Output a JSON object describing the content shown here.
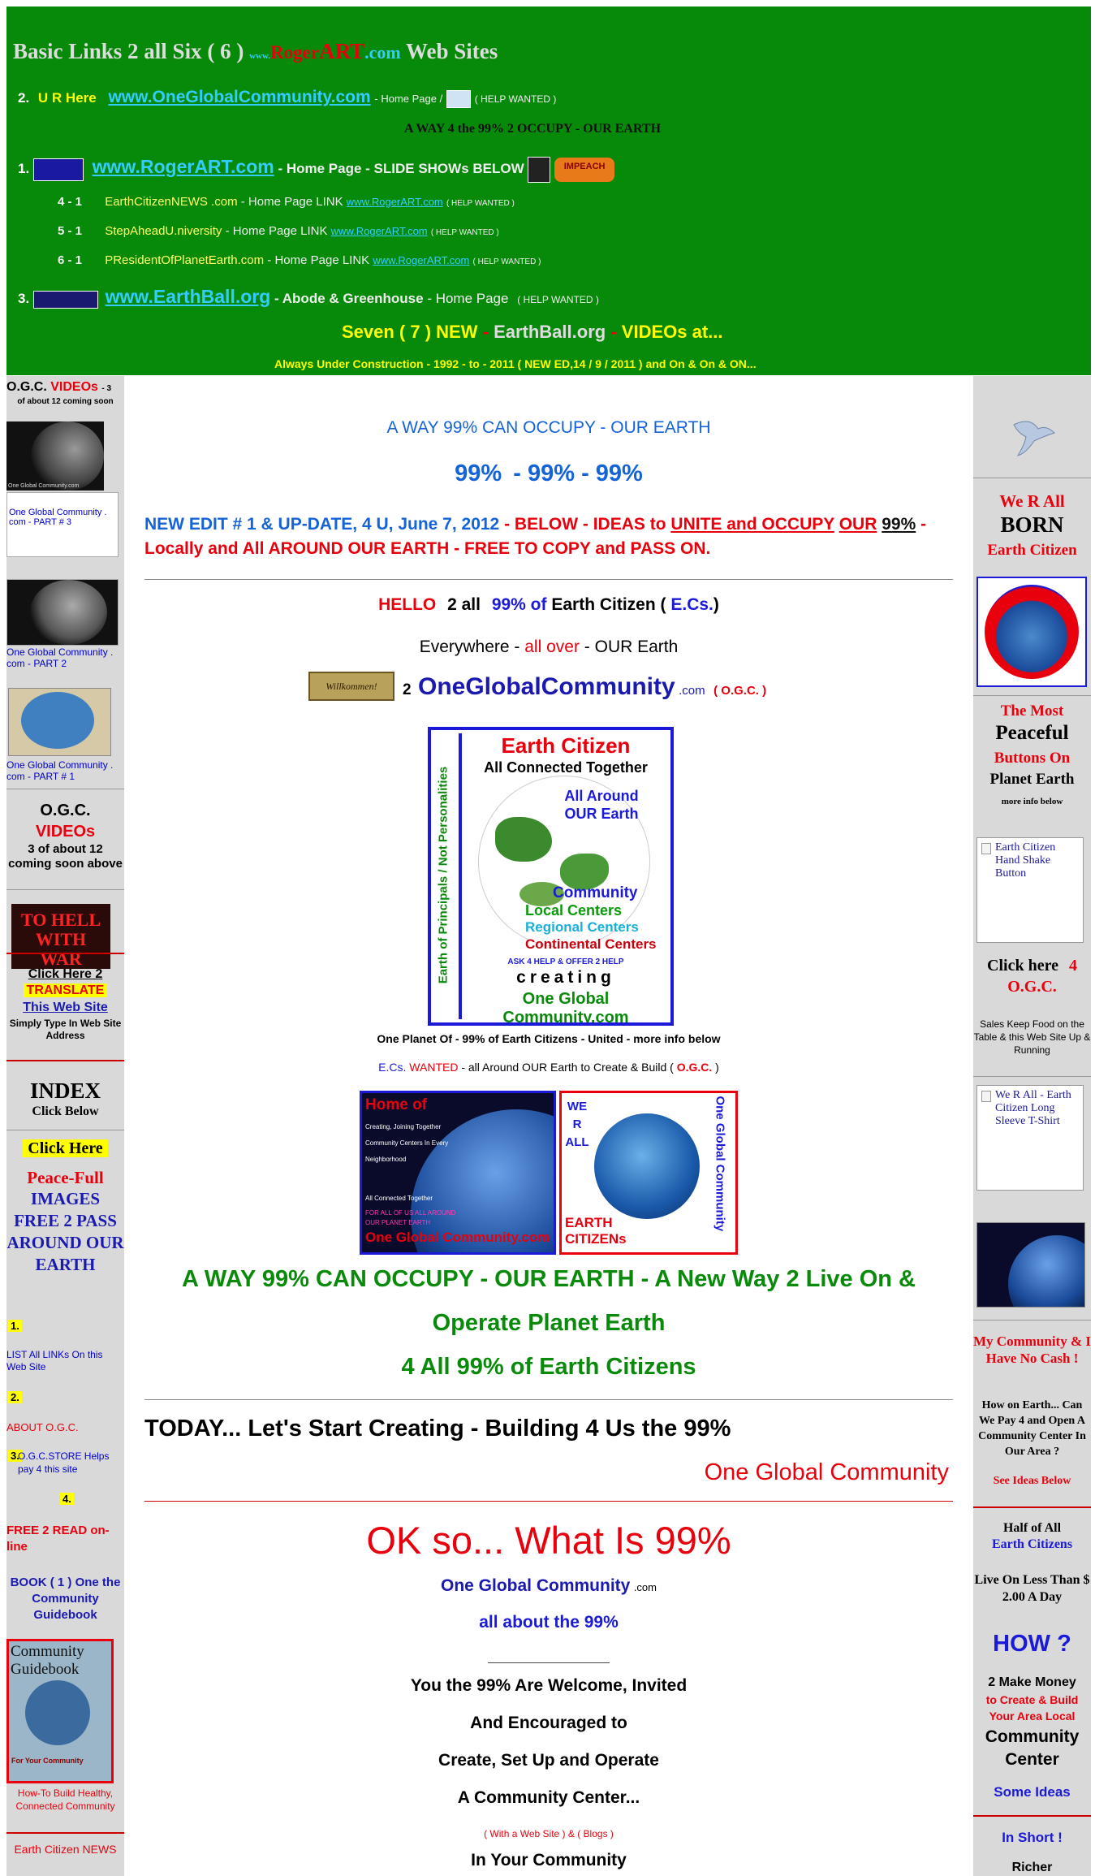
{
  "header": {
    "title_prefix": "Basic Links 2 all Six ( 6 )",
    "title_www": "www.",
    "title_roger": "Roger",
    "title_art": "ART",
    "title_dotcom": ".com",
    "title_suffix": "Web Sites",
    "row2_num": "2.",
    "row2_here": "U R Here",
    "row2_link": "www.OneGlobalCommunity.com",
    "row2_home": "- Home Page /",
    "row2_help": "( HELP WANTED )",
    "tagline": "A WAY 4 the 99% 2 OCCUPY - OUR EARTH",
    "row1_num": "1.",
    "row1_link": "www.RogerART.com",
    "row1_home": "- Home Page - SLIDE SHOWs BELOW",
    "impeach_label": "IMPEACH",
    "sub_rows": [
      {
        "num": "4 - 1",
        "site": "EarthCitizenNEWS .com",
        "text": "- Home Page LINK",
        "link": "www.RogerART.com",
        "help": "( HELP WANTED )"
      },
      {
        "num": "5 - 1",
        "site": "StepAheadU.niversity",
        "text": "- Home Page LINK",
        "link": "www.RogerART.com",
        "help": "( HELP WANTED )"
      },
      {
        "num": "6 - 1",
        "site": "PResidentOfPlanetEarth.com",
        "text": "- Home Page LINK",
        "link": "www.RogerART.com",
        "help": "( HELP WANTED )"
      }
    ],
    "row3_num": "3.",
    "row3_link": "www.EarthBall.org",
    "row3_home": "- Abode & Greenhouse",
    "row3_home2": "- Home Page",
    "row3_help": "( HELP WANTED )",
    "videos_line_a": "Seven ( 7 ) NEW",
    "videos_line_b": "EarthBall.org",
    "videos_line_c": "VIDEOs at...",
    "construction": "Always Under Construction - 1992 - to - 2011 ( NEW ED,14 / 9 /  2011 ) and  On & On & ON..."
  },
  "left": {
    "videos_title_a": "O.G.C.",
    "videos_title_b": "VIDEOs",
    "videos_title_c": "- 3",
    "videos_sub": "of about 12 coming soon",
    "part3": "One Global Community . com - PART # 3",
    "part2": "One Global Community . com - PART 2",
    "part1": "One Global Community . com - PART # 1",
    "thumb_caption": "One Global Community.com",
    "ogc_a": "O.G.C.",
    "ogc_b": "VIDEOs",
    "ogc_c": "3 of about 12 coming soon above",
    "to_hell": "TO HELL WITH WAR",
    "click_here": "Click Here 2",
    "translate": "TRANSLATE",
    "this_web_site": "This Web Site",
    "simply_type": "Simply Type In Web Site Address",
    "index": "INDEX",
    "index_sub": "Click Below",
    "click_here2": "Click Here",
    "peacefull": "Peace-Full",
    "images": "IMAGES FREE 2 PASS AROUND OUR EARTH",
    "n1": "1.",
    "list_all": "LIST All LINKs On this Web Site",
    "n2": "2.",
    "about": "ABOUT O.G.C.",
    "n3": "3.",
    "store": "O.G.C.STORE Helps pay 4 this site",
    "n4": "4.",
    "free_read": "FREE 2 READ on-line",
    "book": "BOOK ( 1 ) One the Community Guidebook",
    "guidebook_title": "Community Guidebook",
    "guidebook_sub": "For Your Community",
    "howto": "How-To Build Healthy, Connected Community",
    "ecnews": "Earth Citizen NEWS"
  },
  "main": {
    "way99": "A WAY 99% CAN OCCUPY - OUR EARTH",
    "pct_a": "99%",
    "pct_b": "-  99%  -  99%",
    "edit_blue": "NEW EDIT # 1 & UP-DATE, 4 U, June 7, 2012",
    "edit_red1": "- BELOW - IDEAS to",
    "edit_unite": "UNITE and OCCUPY",
    "edit_our": "OUR",
    "edit_99": "99%",
    "edit_red2": "- Locally and All AROUND OUR EARTH - FREE TO COPY and PASS ON.",
    "hello_a": "HELLO",
    "hello_b": "2 all",
    "hello_c": "99% of",
    "hello_d": "Earth  Citizen (",
    "hello_e": "E.Cs.",
    "hello_f": ")",
    "everywhere_a": "Everywhere -",
    "everywhere_b": "all over",
    "everywhere_c": "- OUR Earth",
    "willkommen": "Willkommen!",
    "two": "2",
    "ogc_big": "OneGlobalCommunity",
    "ogc_dotcom": ".com",
    "ogc_paren": "( O.G.C. )",
    "poster": {
      "title": "Earth Citizen",
      "sub": "All Connected Together",
      "side": "Earth of Principals / Not Personalities",
      "around": "All Around OUR Earth",
      "community": "Community",
      "local": "Local Centers",
      "regional": "Regional Centers",
      "continental": "Continental Centers",
      "ask": "ASK 4 HELP & OFFER 2 HELP",
      "creating": "creating",
      "ogc": "One Global Community.com"
    },
    "one_planet": "One Planet Of - 99% of Earth Citizens - United - more info below",
    "wanted_a": "E.Cs.",
    "wanted_b": "WANTED",
    "wanted_c": "- all Around OUR Earth to Create & Build (",
    "wanted_d": "O.G.C.",
    "wanted_e": ")",
    "home_of": "Home of",
    "home_list": "Creating, Joining Together Community Centers In Every Neighborhood",
    "home_connected": "All Connected Together",
    "home_forall": "FOR ALL OF US ALL AROUND OUR PLANET EARTH",
    "home_ogc": "One Global Community.com",
    "werall": "WE R ALL",
    "earth_citizens": "EARTH CITIZENs",
    "ogc_vertical": "One Global Community",
    "green1": "A WAY 99% CAN OCCUPY - OUR EARTH - A New Way 2 Live On &",
    "green2": "Operate Planet Earth",
    "green3": "4 All 99% of Earth Citizens",
    "today": "TODAY... Let's Start Creating - Building 4 Us the 99%",
    "ogc_red": "One Global Community",
    "ok": "OK so... What Is 99%",
    "ogc_line": "One Global Community",
    "ogc_line_com": ".com",
    "about99": "all about the 99%",
    "you1": "You the 99% Are Welcome, Invited",
    "you2": "And Encouraged to",
    "you3": "Create, Set Up and Operate",
    "you4": "A Community Center...",
    "web_site": "( With a Web Site ) & ( Blogs )",
    "in_your": "In Your Community"
  },
  "right": {
    "werall": "We R All",
    "born": "BORN",
    "earth_citizen": "Earth Citizen",
    "most": "The Most",
    "peaceful": "Peaceful",
    "buttons_on": "Buttons On",
    "planet": "Planet Earth",
    "more_info": "more info below",
    "handshake": "Earth Citizen Hand Shake Button",
    "click_here": "Click here",
    "four": "4",
    "ogc": "O.G.C.",
    "sales": "Sales Keep Food on the Table & this Web Site Up & Running",
    "tshirt": "We R All - Earth Citizen Long Sleeve T-Shirt",
    "my_comm": "My Community & I Have No Cash !",
    "how_on": "How on Earth... Can We Pay 4 and Open A Community Center In Our Area ?",
    "see_ideas": "See Ideas Below",
    "half": "Half of All",
    "earth_citizens": "Earth Citizens",
    "live_on": "Live On Less Than $ 2.00 A Day",
    "how": "HOW ?",
    "make_money": "2 Make Money",
    "create_build": "to Create & Build Your Area Local",
    "comm_center": "Community Center",
    "some_ideas": "Some Ideas",
    "in_short": "In Short !",
    "richer": "Richer"
  }
}
